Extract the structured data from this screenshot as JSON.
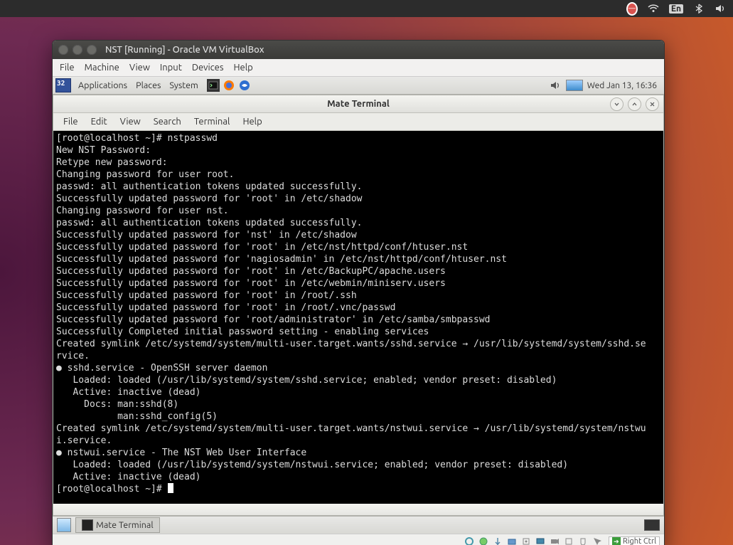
{
  "host": {
    "tray": {
      "lang": "En"
    }
  },
  "vbox": {
    "title": "NST [Running] - Oracle VM VirtualBox",
    "menu": [
      "File",
      "Machine",
      "View",
      "Input",
      "Devices",
      "Help"
    ],
    "status": {
      "host_key": "Right Ctrl"
    }
  },
  "guest": {
    "panel": {
      "badge": "32",
      "menus": [
        "Applications",
        "Places",
        "System"
      ],
      "clock": "Wed Jan 13, 16:36"
    },
    "bottom": {
      "task_label": "Mate Terminal"
    }
  },
  "terminal": {
    "window_title": "Mate Terminal",
    "menu": [
      "File",
      "Edit",
      "View",
      "Search",
      "Terminal",
      "Help"
    ],
    "lines": [
      "[root@localhost ~]# nstpasswd",
      "New NST Password:",
      "Retype new password:",
      "Changing password for user root.",
      "passwd: all authentication tokens updated successfully.",
      "Successfully updated password for 'root' in /etc/shadow",
      "Changing password for user nst.",
      "passwd: all authentication tokens updated successfully.",
      "Successfully updated password for 'nst' in /etc/shadow",
      "Successfully updated password for 'root' in /etc/nst/httpd/conf/htuser.nst",
      "Successfully updated password for 'nagiosadmin' in /etc/nst/httpd/conf/htuser.nst",
      "Successfully updated password for 'root' in /etc/BackupPC/apache.users",
      "Successfully updated password for 'root' in /etc/webmin/miniserv.users",
      "Successfully updated password for 'root' in /root/.ssh",
      "Successfully updated password for 'root' in /root/.vnc/passwd",
      "Successfully updated password for 'root/administrator' in /etc/samba/smbpasswd",
      "Successfully Completed initial password setting - enabling services",
      "Created symlink /etc/systemd/system/multi-user.target.wants/sshd.service → /usr/lib/systemd/system/sshd.se",
      "rvice.",
      "● sshd.service - OpenSSH server daemon",
      "   Loaded: loaded (/usr/lib/systemd/system/sshd.service; enabled; vendor preset: disabled)",
      "   Active: inactive (dead)",
      "     Docs: man:sshd(8)",
      "           man:sshd_config(5)",
      "Created symlink /etc/systemd/system/multi-user.target.wants/nstwui.service → /usr/lib/systemd/system/nstwu",
      "i.service.",
      "● nstwui.service - The NST Web User Interface",
      "   Loaded: loaded (/usr/lib/systemd/system/nstwui.service; enabled; vendor preset: disabled)",
      "   Active: inactive (dead)",
      "[root@localhost ~]# "
    ]
  }
}
